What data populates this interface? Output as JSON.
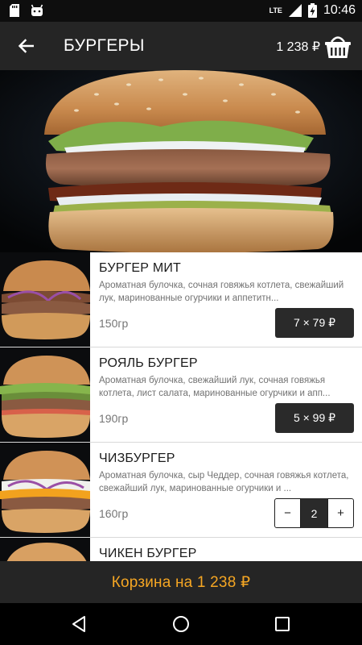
{
  "status_bar": {
    "network": "LTE",
    "time": "10:46"
  },
  "app_bar": {
    "title": "БУРГЕРЫ",
    "cart_total": "1 238 ₽"
  },
  "products": [
    {
      "name": "БУРГЕР МИТ",
      "description": "Ароматная булочка, сочная говяжья котлета, свежайший лук, маринованные огурчики и аппетитн...",
      "weight": "150гр",
      "order": "7 × 79 ₽"
    },
    {
      "name": "РОЯЛЬ БУРГЕР",
      "description": "Ароматная булочка, свежайший лук, сочная говяжья котлета, лист салата, маринованные огурчики и апп...",
      "weight": "190гр",
      "order": "5 × 99 ₽"
    },
    {
      "name": "ЧИЗБУРГЕР",
      "description": "Ароматная булочка, сыр Чеддер, сочная говяжья котлета, свежайший лук, маринованные огурчики и ...",
      "weight": "160гр",
      "stepper": {
        "minus": "−",
        "value": "2",
        "plus": "+"
      }
    },
    {
      "name": "ЧИКЕН БУРГЕР"
    }
  ],
  "cart_bar": {
    "label": "Корзина на 1 238 ₽"
  },
  "colors": {
    "accent": "#f5a623",
    "bar": "#252525",
    "pill": "#2a2a2a"
  }
}
